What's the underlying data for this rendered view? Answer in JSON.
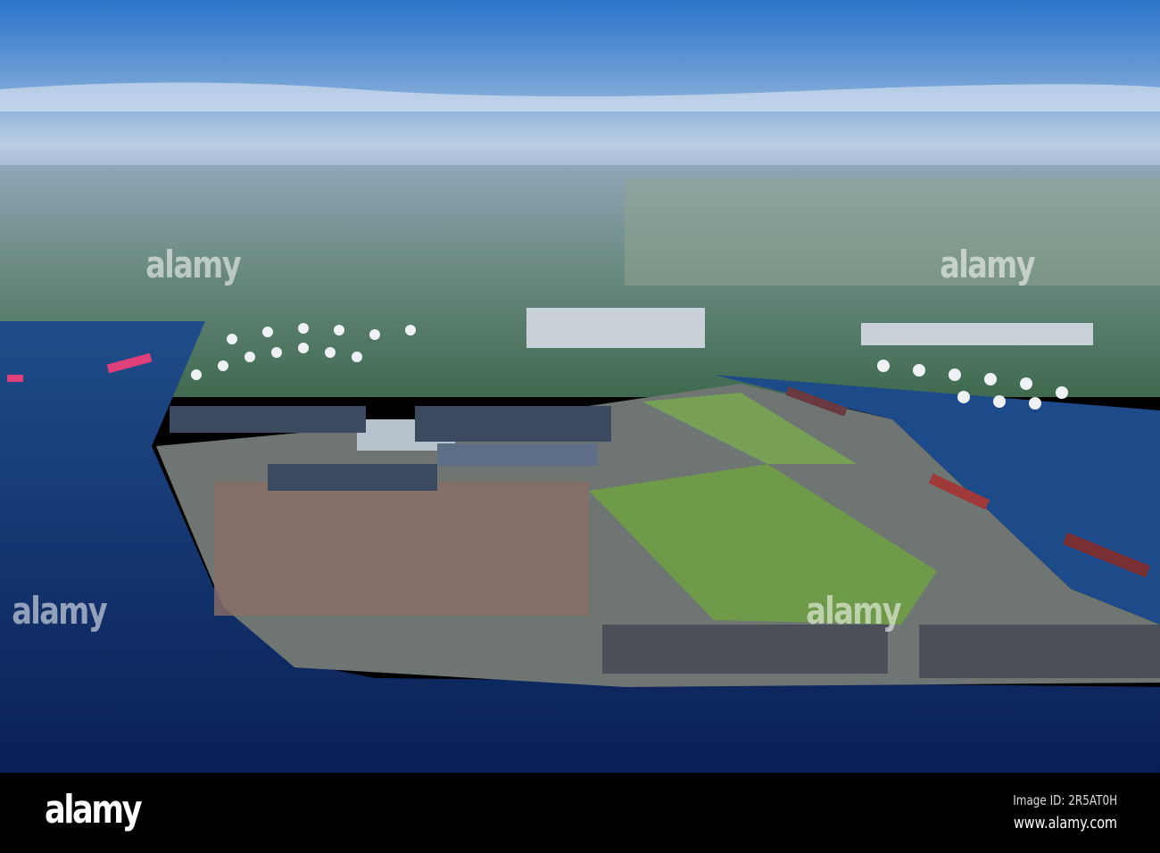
{
  "photo": {
    "subject": "Aerial view of port with container terminal"
  },
  "watermark": {
    "text": "alamy"
  },
  "footer": {
    "logo": "alamy",
    "image_id": "Image ID: 2R5AT0H",
    "url": "www.alamy.com"
  },
  "colors": {
    "sky_top": "#2f78c8",
    "haze": "#b8cbe0",
    "water": "#0f2a6a",
    "land": "#5f7f72"
  }
}
